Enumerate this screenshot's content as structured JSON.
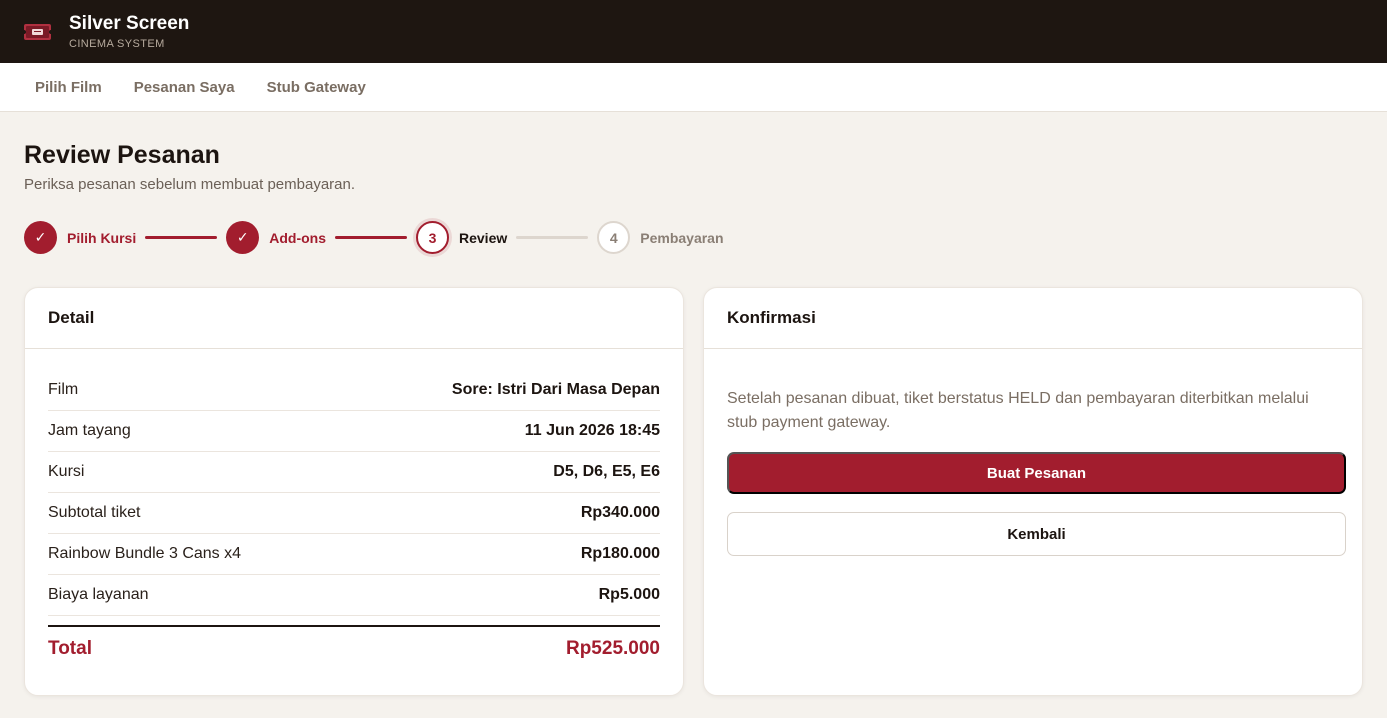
{
  "app": {
    "title": "Silver Screen",
    "subtitle": "CINEMA SYSTEM",
    "logo_icon": "ticket-icon"
  },
  "nav": {
    "items": [
      "Pilih Film",
      "Pesanan Saya",
      "Stub Gateway"
    ]
  },
  "page": {
    "title": "Review Pesanan",
    "subtitle": "Periksa pesanan sebelum membuat pembayaran."
  },
  "stepper": {
    "steps": [
      {
        "number": "1",
        "label": "Pilih Kursi",
        "state": "done",
        "icon": "check-icon",
        "glyph": "✓"
      },
      {
        "number": "2",
        "label": "Add-ons",
        "state": "done",
        "icon": "check-icon",
        "glyph": "✓"
      },
      {
        "number": "3",
        "label": "Review",
        "state": "active"
      },
      {
        "number": "4",
        "label": "Pembayaran",
        "state": "todo"
      }
    ]
  },
  "detail": {
    "heading": "Detail",
    "rows": [
      {
        "label": "Film",
        "value": "Sore: Istri Dari Masa Depan"
      },
      {
        "label": "Jam tayang",
        "value": "11 Jun 2026 18:45"
      },
      {
        "label": "Kursi",
        "value": "D5, D6, E5, E6"
      },
      {
        "label": "Subtotal tiket",
        "value": "Rp340.000"
      },
      {
        "label": "Rainbow Bundle 3 Cans x4",
        "value": "Rp180.000"
      },
      {
        "label": "Biaya layanan",
        "value": "Rp5.000"
      }
    ],
    "total_label": "Total",
    "total_value": "Rp525.000"
  },
  "confirm": {
    "heading": "Konfirmasi",
    "text": "Setelah pesanan dibuat, tiket berstatus HELD dan pembayaran diterbitkan melalui stub payment gateway.",
    "primary_button": "Buat Pesanan",
    "secondary_button": "Kembali"
  },
  "colors": {
    "brand": "#a21d2e",
    "topbar": "#1e1611",
    "background": "#f5f2ed"
  }
}
